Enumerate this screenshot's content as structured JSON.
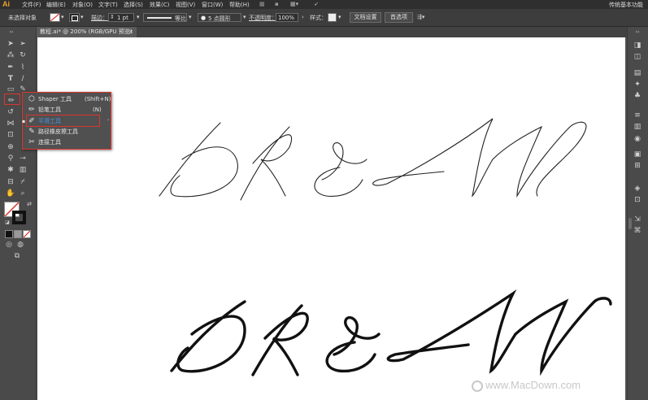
{
  "app": {
    "logo": "Ai",
    "workspace": "传统基本功能"
  },
  "menu": [
    "文件(F)",
    "编辑(E)",
    "对象(O)",
    "文字(T)",
    "选择(S)",
    "效果(C)",
    "视图(V)",
    "窗口(W)",
    "帮助(H)"
  ],
  "controlbar": {
    "selection_status": "未选择对象",
    "stroke_label": "描边：",
    "stroke_value": "1 pt",
    "profile_label": "等比",
    "brush_value": "5 点圆形",
    "opacity_label": "不透明度：",
    "opacity_value": "100%",
    "style_label": "样式：",
    "doc_setup_button": "文档设置",
    "prefs_button": "首选项"
  },
  "document": {
    "tab_title": "教程.ai* @ 200% (RGB/GPU 预览)",
    "close": "×"
  },
  "flyout": {
    "items": [
      {
        "icon": "shaper-icon",
        "label": "Shaper 工具",
        "shortcut": "(Shift+N)"
      },
      {
        "icon": "pencil-icon",
        "label": "铅笔工具",
        "shortcut": "(N)"
      },
      {
        "icon": "smooth-icon",
        "label": "平滑工具",
        "shortcut": ""
      },
      {
        "icon": "path-eraser-icon",
        "label": "路径橡皮擦工具",
        "shortcut": ""
      },
      {
        "icon": "join-icon",
        "label": "连接工具",
        "shortcut": ""
      }
    ],
    "selected_index": 2
  },
  "canvas_art": {
    "word_thin": "DREAM",
    "word_bold": "DREAM"
  },
  "watermark": {
    "text": "www.MacDown.com"
  },
  "colors": {
    "accent_highlight": "#d9352f",
    "selected_item_text": "#4a8fe0",
    "canvas": "#ffffff"
  }
}
